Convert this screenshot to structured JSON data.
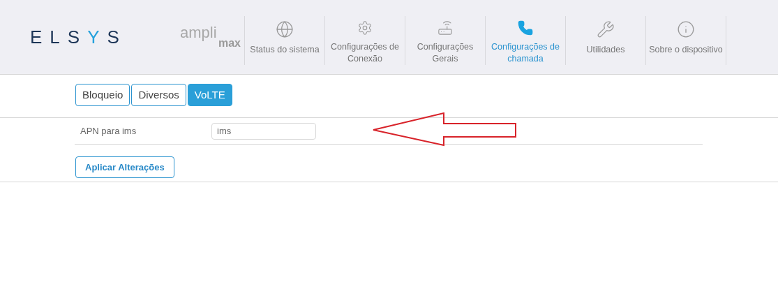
{
  "header": {
    "logo": "ELSYS",
    "product": {
      "line1": "ampli",
      "line2": "max"
    },
    "nav": [
      {
        "label": "Status do sistema",
        "kind": "globe",
        "selected": false
      },
      {
        "label": "Configurações de Conexão",
        "kind": "gear",
        "selected": false
      },
      {
        "label": "Configurações Gerais",
        "kind": "router",
        "selected": false
      },
      {
        "label": "Configurações de chamada",
        "kind": "phone",
        "selected": true
      },
      {
        "label": "Utilidades",
        "kind": "tools",
        "selected": false
      },
      {
        "label": "Sobre o dispositivo",
        "kind": "info",
        "selected": false
      }
    ]
  },
  "tabs": [
    {
      "label": "Bloqueio",
      "selected": false
    },
    {
      "label": "Diversos",
      "selected": false
    },
    {
      "label": "VoLTE",
      "selected": true
    }
  ],
  "form": {
    "label": "APN para ims",
    "value": "ims"
  },
  "apply_button": "Aplicar Alterações"
}
